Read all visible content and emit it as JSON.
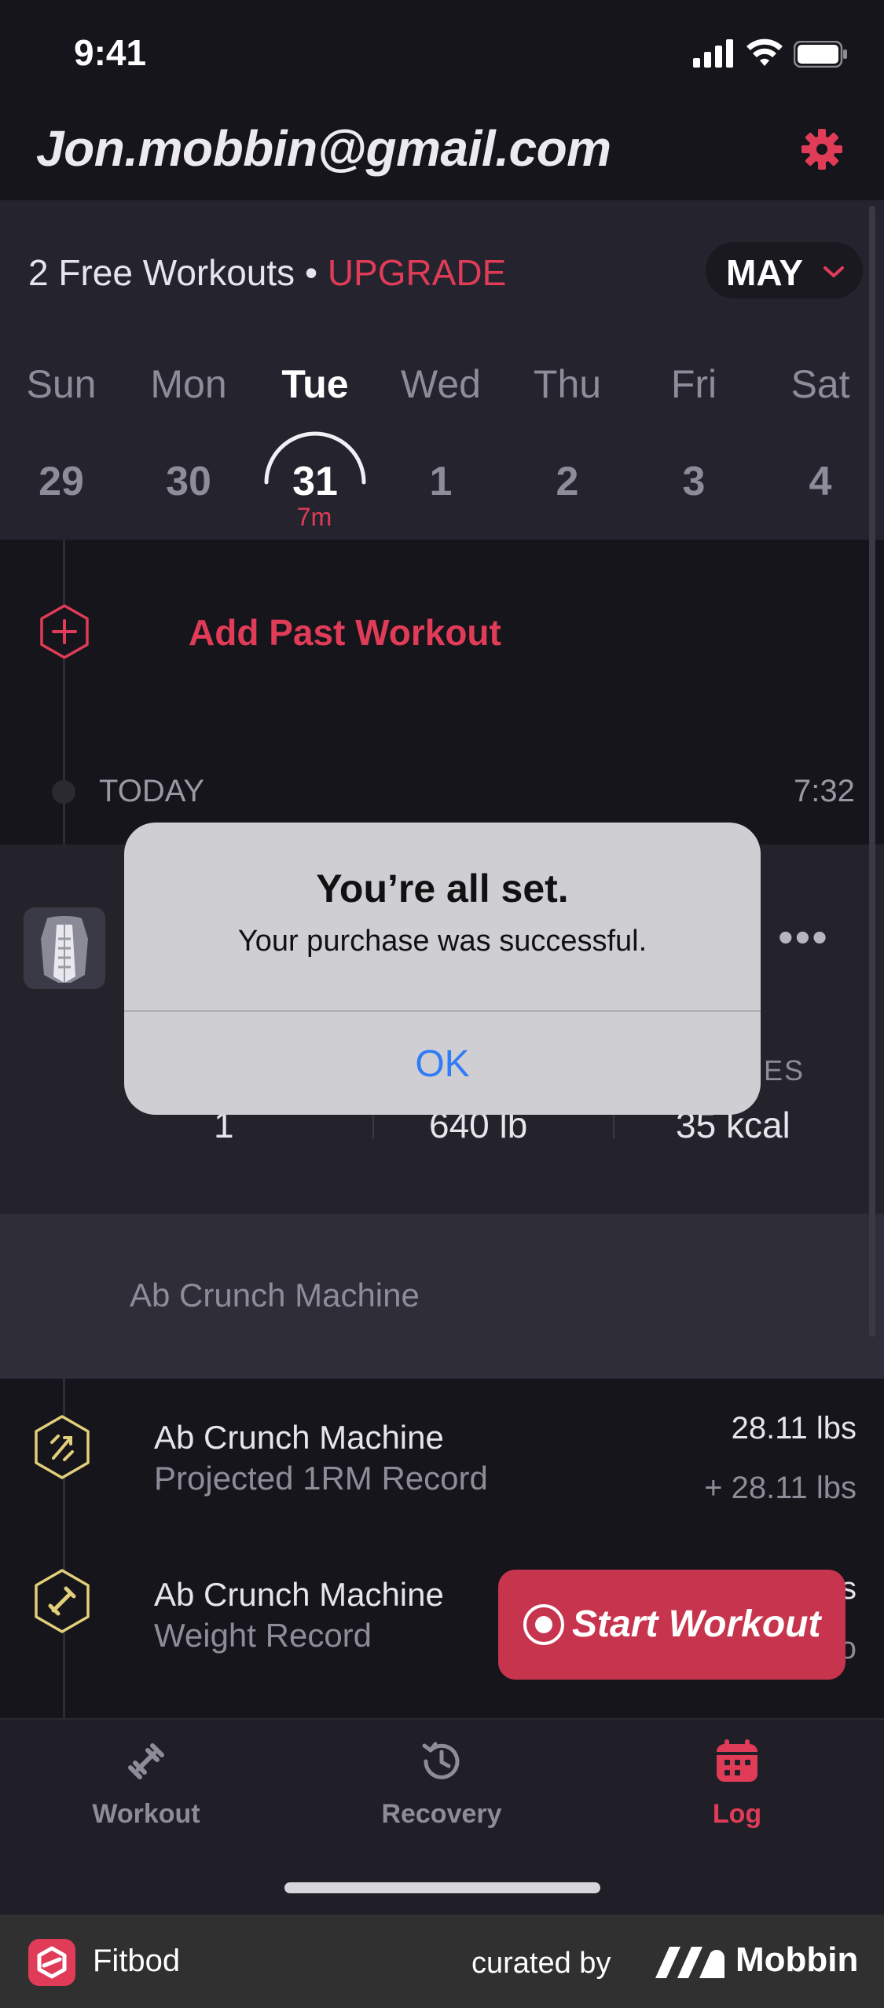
{
  "status_bar": {
    "time": "9:41"
  },
  "header": {
    "email": "Jon.mobbin@gmail.com"
  },
  "plan": {
    "free_text": "2 Free Workouts • ",
    "upgrade": "UPGRADE"
  },
  "month": {
    "label": "MAY"
  },
  "week": {
    "days": [
      {
        "name": "Sun",
        "num": "29"
      },
      {
        "name": "Mon",
        "num": "30"
      },
      {
        "name": "Tue",
        "num": "31",
        "minutes": "7m"
      },
      {
        "name": "Wed",
        "num": "1"
      },
      {
        "name": "Thu",
        "num": "2"
      },
      {
        "name": "Fri",
        "num": "3"
      },
      {
        "name": "Sat",
        "num": "4"
      }
    ]
  },
  "timeline": {
    "add_label": "Add Past Workout",
    "today_label": "TODAY",
    "today_time": "7:32"
  },
  "workout_card": {
    "more": "•••",
    "stat_caption_partial": "RIES",
    "stats": [
      "1",
      "640 lb",
      "35 kcal"
    ]
  },
  "exercise_band": {
    "label": "Ab Crunch Machine"
  },
  "records": [
    {
      "title": "Ab Crunch Machine",
      "subtitle": "Projected 1RM Record",
      "value": "28.11 lbs",
      "delta": "+ 28.11 lbs"
    },
    {
      "title": "Ab Crunch Machine",
      "subtitle": "Weight Record",
      "value_partial": "s",
      "delta_partial": "o"
    }
  ],
  "start_button": {
    "label": "Start Workout"
  },
  "tabs": [
    {
      "label": "Workout",
      "icon": "dumbbell-icon"
    },
    {
      "label": "Recovery",
      "icon": "recovery-clock-icon"
    },
    {
      "label": "Log",
      "icon": "calendar-icon"
    }
  ],
  "dialog": {
    "title": "You’re all set.",
    "message": "Your purchase was successful.",
    "ok": "OK"
  },
  "footer": {
    "app_name": "Fitbod",
    "curated_by": "curated by",
    "brand": "Mobbin"
  },
  "colors": {
    "accent": "#e03c58",
    "background": "#16151b",
    "ios_blue": "#2f7cf6"
  }
}
